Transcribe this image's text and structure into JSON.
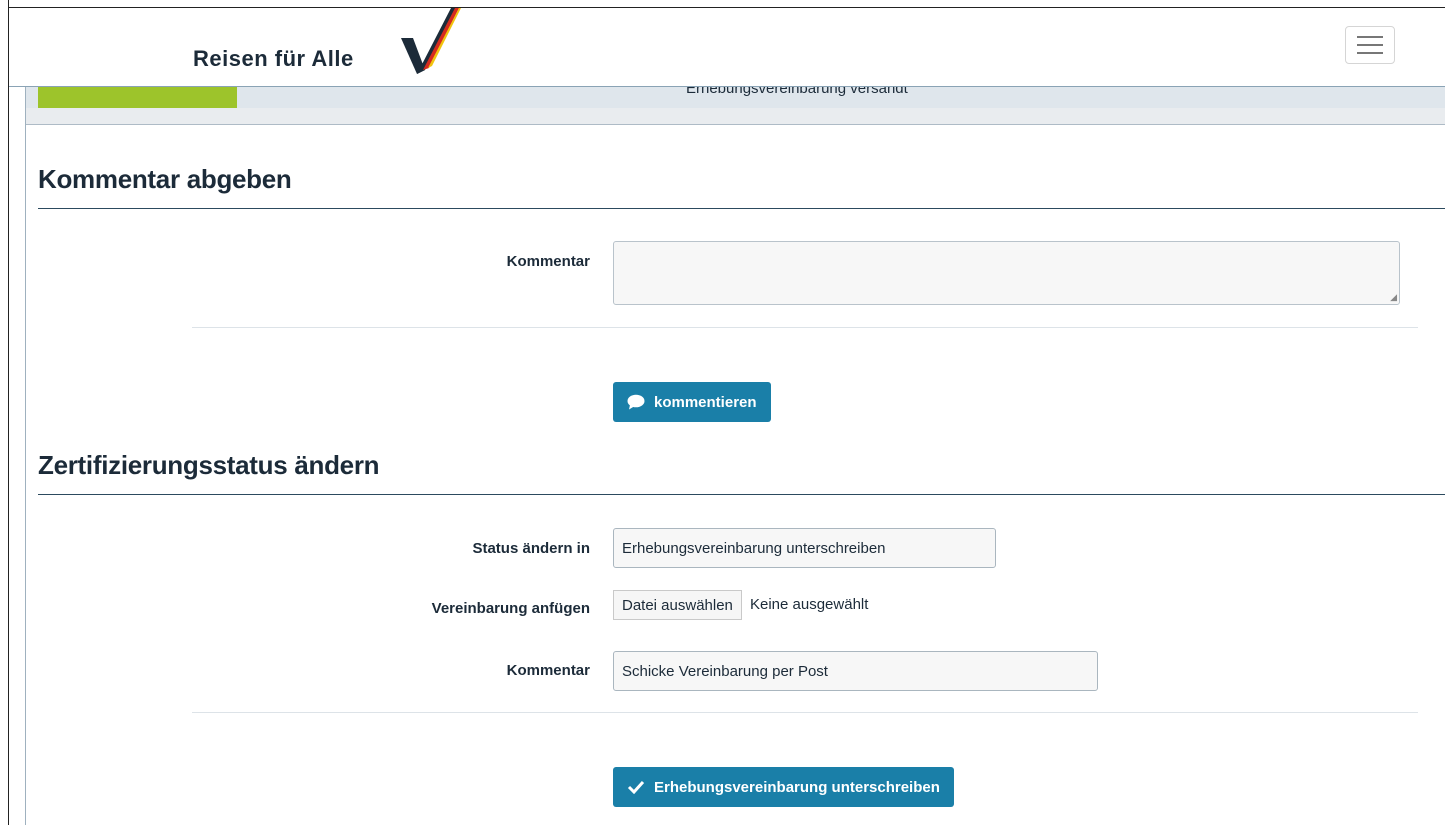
{
  "brand": {
    "name": "Reisen für Alle"
  },
  "progress": {
    "step_label": "Erhebungsvereinbarung versandt"
  },
  "comment_section": {
    "title": "Kommentar abgeben",
    "field_label": "Kommentar",
    "field_value": "",
    "submit_label": "kommentieren",
    "submit_icon": "speech-bubble-icon"
  },
  "status_section": {
    "title": "Zertifizierungsstatus ändern",
    "status_label": "Status ändern in",
    "status_value": "Erhebungsvereinbarung unterschreiben",
    "attach_label": "Vereinbarung anfügen",
    "file_button_label": "Datei auswählen",
    "file_status": "Keine ausgewählt",
    "comment_label": "Kommentar",
    "comment_value": "Schicke Vereinbarung per Post",
    "submit_label": "Erhebungsvereinbarung unterschreiben",
    "submit_icon": "checkmark-icon"
  },
  "colors": {
    "accent": "#1a7fa8",
    "progress_green": "#9dc42b",
    "text": "#1c2b39"
  }
}
